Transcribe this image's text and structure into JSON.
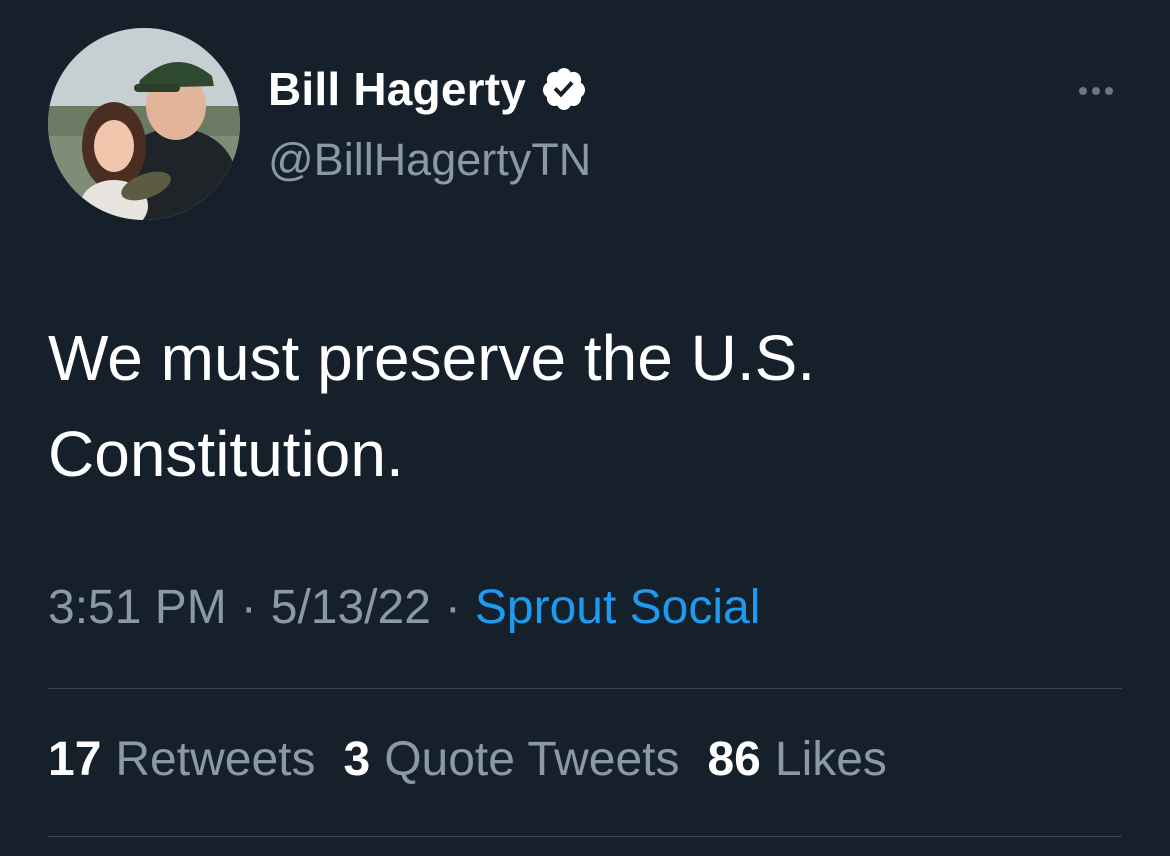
{
  "author": {
    "display_name": "Bill Hagerty",
    "handle": "@BillHagertyTN",
    "verified": true
  },
  "tweet": {
    "text_line1": "We must preserve the U.S.",
    "text_line2": "Constitution."
  },
  "meta": {
    "time": "3:51 PM",
    "separator": "·",
    "date": "5/13/22",
    "source": "Sprout Social"
  },
  "stats": [
    {
      "count": "17",
      "label": "Retweets"
    },
    {
      "count": "3",
      "label": "Quote Tweets"
    },
    {
      "count": "86",
      "label": "Likes"
    }
  ],
  "colors": {
    "background": "#15202b",
    "secondary_text": "#8b98a5",
    "link": "#1d9bf0",
    "divider": "#38444d"
  },
  "icons": {
    "verified": "verified-badge-icon",
    "more": "more-options-icon"
  }
}
